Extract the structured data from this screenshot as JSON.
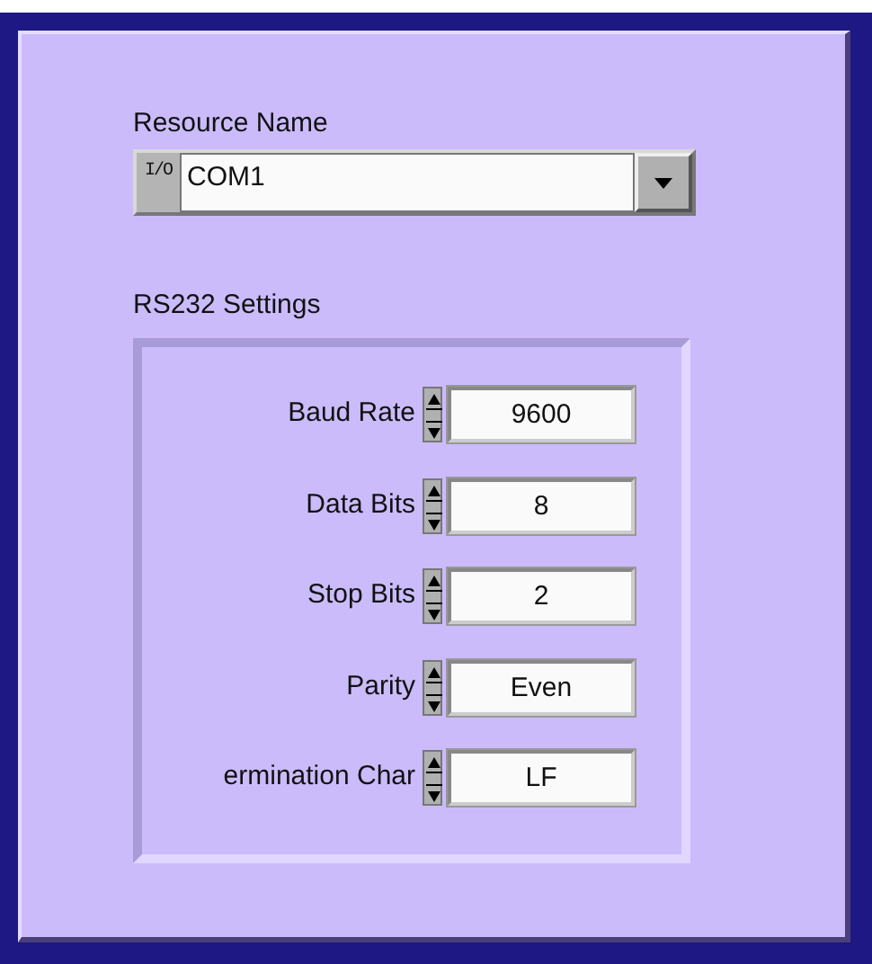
{
  "resource_name": {
    "label": "Resource Name",
    "prefix": "I/O",
    "value": "COM1"
  },
  "rs232_settings": {
    "label": "RS232 Settings",
    "fields": [
      {
        "label": "Baud Rate",
        "value": "9600"
      },
      {
        "label": "Data Bits",
        "value": "8"
      },
      {
        "label": "Stop Bits",
        "value": "2"
      },
      {
        "label": "Parity",
        "value": "Even"
      },
      {
        "label": "ermination Char",
        "value": "LF"
      }
    ]
  }
}
